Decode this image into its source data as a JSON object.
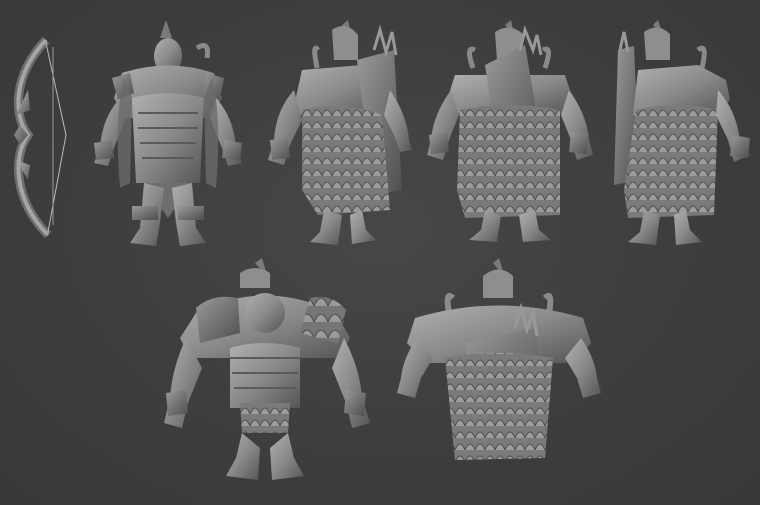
{
  "scene": {
    "background_color": "#3e3e3e",
    "clay_color": "#8a8a8a",
    "clay_dark": "#5a5a5a",
    "clay_light": "#b4b4b4",
    "views": [
      {
        "name": "bow-weapon",
        "angle": "side"
      },
      {
        "name": "orc-archer-front",
        "angle": "front"
      },
      {
        "name": "orc-archer-back-left",
        "angle": "three-quarter-back"
      },
      {
        "name": "orc-archer-back",
        "angle": "back"
      },
      {
        "name": "orc-archer-back-right",
        "angle": "three-quarter-back"
      },
      {
        "name": "orc-archer-perspective-front",
        "angle": "perspective-front"
      },
      {
        "name": "orc-archer-perspective-back",
        "angle": "perspective-back"
      }
    ]
  }
}
